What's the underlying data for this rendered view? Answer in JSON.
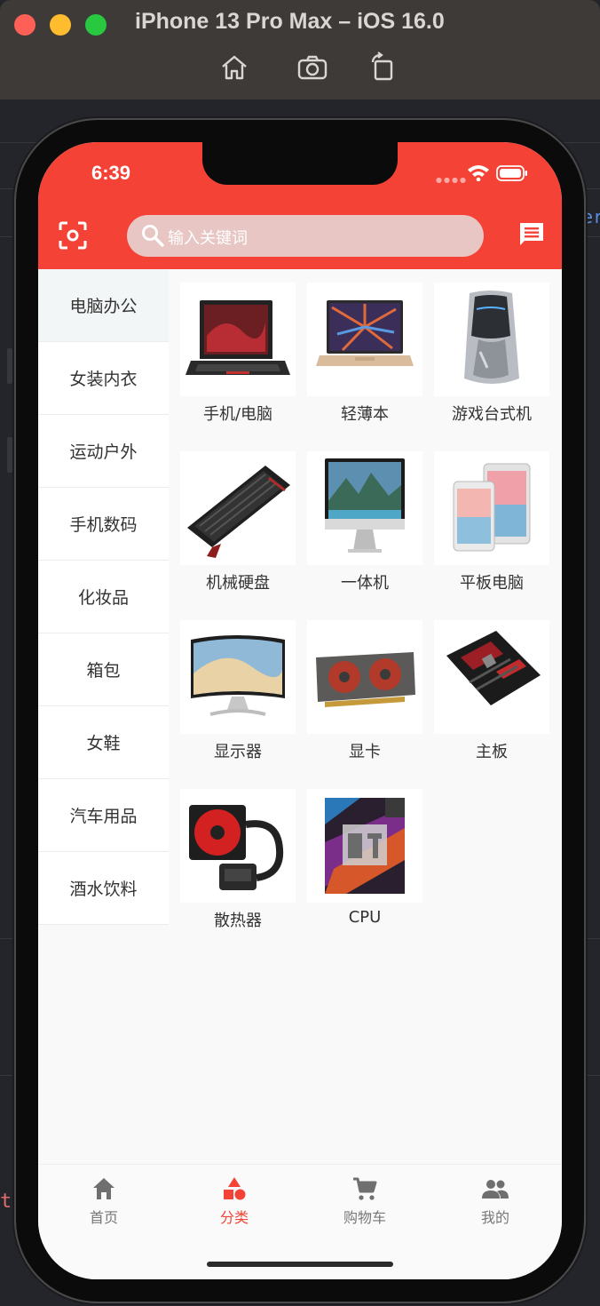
{
  "simulator": {
    "title": "iPhone 13 Pro Max – iOS 16.0",
    "tools": [
      {
        "icon": "home-icon"
      },
      {
        "icon": "screenshot-icon"
      },
      {
        "icon": "rotate-icon"
      }
    ]
  },
  "background_editor": {
    "fragment_left": "t",
    "fragment_right": "er"
  },
  "status_bar": {
    "time": "6:39"
  },
  "header": {
    "scan_icon": "scan-icon",
    "search_placeholder": "输入关键词",
    "message_icon": "message-icon",
    "accent_color": "#f44336"
  },
  "sidebar": {
    "selected_index": 0,
    "items": [
      {
        "label": "电脑办公"
      },
      {
        "label": "女装内衣"
      },
      {
        "label": "运动户外"
      },
      {
        "label": "手机数码"
      },
      {
        "label": "化妆品"
      },
      {
        "label": "箱包"
      },
      {
        "label": "女鞋"
      },
      {
        "label": "汽车用品"
      },
      {
        "label": "酒水饮料"
      }
    ]
  },
  "products": [
    {
      "label": "手机/电脑",
      "image": "laptop-image"
    },
    {
      "label": "轻薄本",
      "image": "thin-laptop-image"
    },
    {
      "label": "游戏台式机",
      "image": "gaming-desktop-image"
    },
    {
      "label": "机械硬盘",
      "image": "keyboard-image"
    },
    {
      "label": "一体机",
      "image": "all-in-one-image"
    },
    {
      "label": "平板电脑",
      "image": "tablet-image"
    },
    {
      "label": "显示器",
      "image": "monitor-image"
    },
    {
      "label": "显卡",
      "image": "graphics-card-image"
    },
    {
      "label": "主板",
      "image": "motherboard-image"
    },
    {
      "label": "散热器",
      "image": "cooler-image"
    },
    {
      "label": "CPU",
      "image": "cpu-image"
    }
  ],
  "tabbar": {
    "selected_index": 1,
    "tabs": [
      {
        "label": "首页",
        "icon": "home-icon"
      },
      {
        "label": "分类",
        "icon": "category-icon"
      },
      {
        "label": "购物车",
        "icon": "cart-icon"
      },
      {
        "label": "我的",
        "icon": "people-icon"
      }
    ]
  }
}
